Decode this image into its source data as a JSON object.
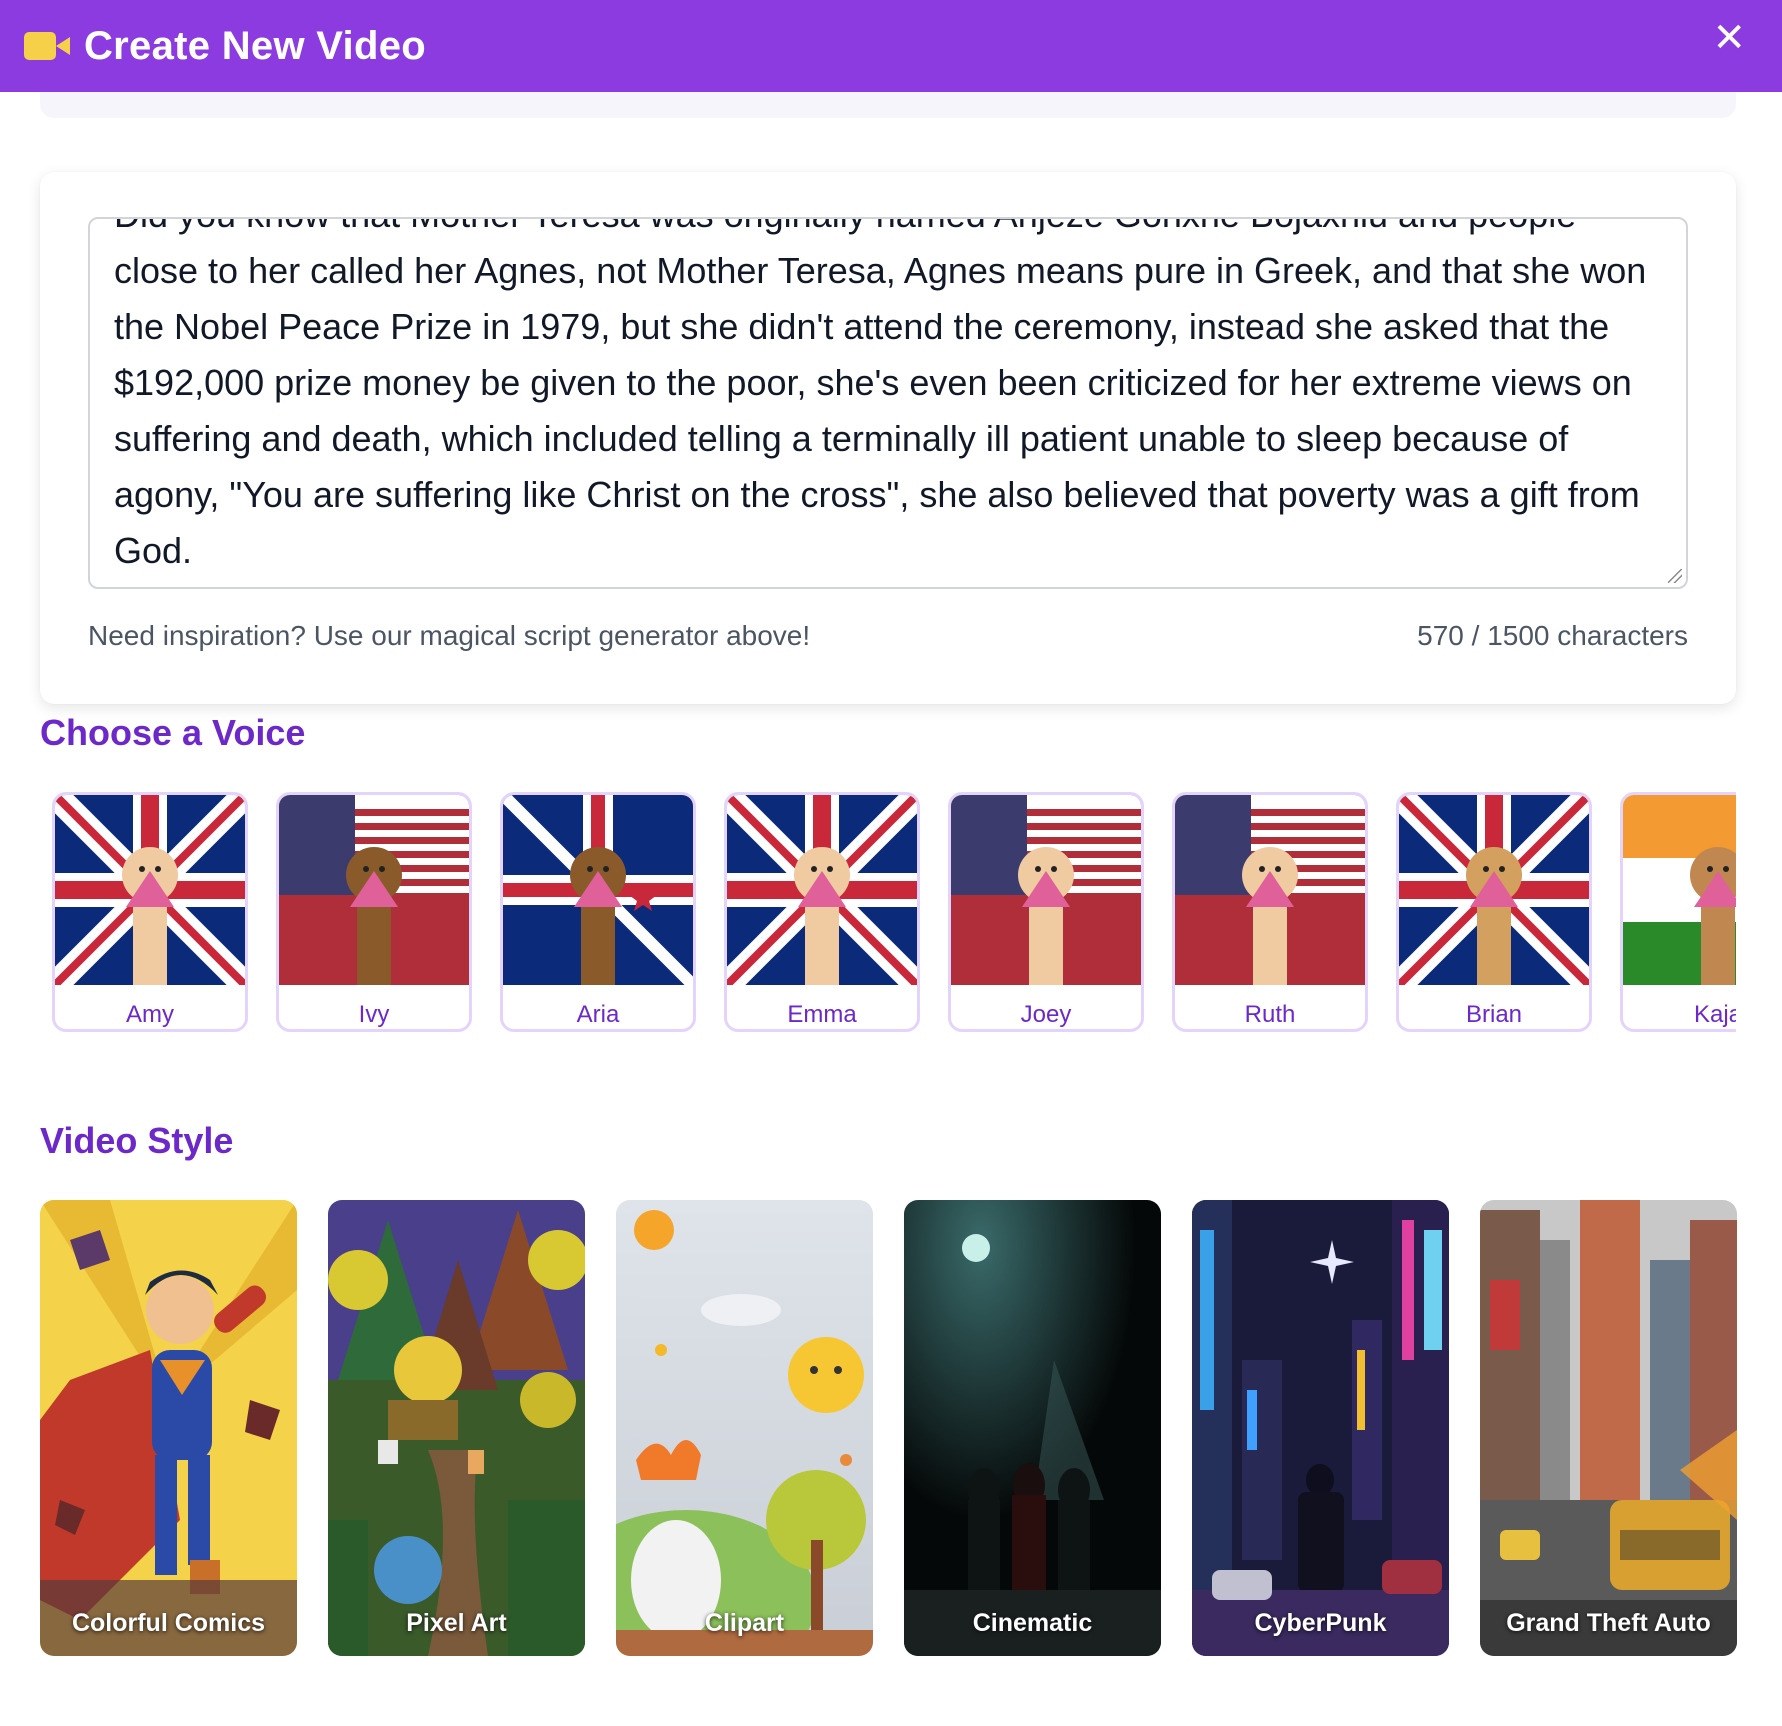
{
  "header": {
    "title": "Create New Video",
    "close_glyph": "✕",
    "icon": "video-camera-icon",
    "accent": "#8b3be0"
  },
  "script": {
    "hidden_first_line": "Did you know that Mother Teresa was originally named Anjezë Gonxhe Bojaxhiu and",
    "text": "people close to her called her Agnes, not Mother Teresa, Agnes means pure in Greek, and that she won the Nobel Peace Prize in 1979, but she didn't attend the ceremony, instead she asked that the $192,000 prize money be given to the poor, she's even been criticized for her extreme views on suffering and death, which included telling a terminally ill patient unable to sleep because of agony, \"You are suffering like Christ on the cross\", she also believed that poverty was a gift from God.",
    "hint": "Need inspiration? Use our magical script generator above!",
    "count": "570 / 1500 characters"
  },
  "voices": {
    "title": "Choose a Voice",
    "items": [
      {
        "name": "Amy",
        "flag": "uk",
        "skin": "#f0caa0"
      },
      {
        "name": "Ivy",
        "flag": "us",
        "skin": "#8a5a2b"
      },
      {
        "name": "Aria",
        "flag": "nz",
        "skin": "#8a5a2b"
      },
      {
        "name": "Emma",
        "flag": "uk",
        "skin": "#f0caa0"
      },
      {
        "name": "Joey",
        "flag": "us",
        "skin": "#f0caa0"
      },
      {
        "name": "Ruth",
        "flag": "us",
        "skin": "#f0caa0"
      },
      {
        "name": "Brian",
        "flag": "uk",
        "skin": "#d4a060"
      },
      {
        "name": "Kaja",
        "flag": "in",
        "skin": "#c08850"
      }
    ]
  },
  "styles": {
    "title": "Video Style",
    "items": [
      {
        "label": "Colorful Comics"
      },
      {
        "label": "Pixel Art"
      },
      {
        "label": "Clipart"
      },
      {
        "label": "Cinematic"
      },
      {
        "label": "CyberPunk"
      },
      {
        "label": "Grand Theft Auto"
      }
    ]
  }
}
